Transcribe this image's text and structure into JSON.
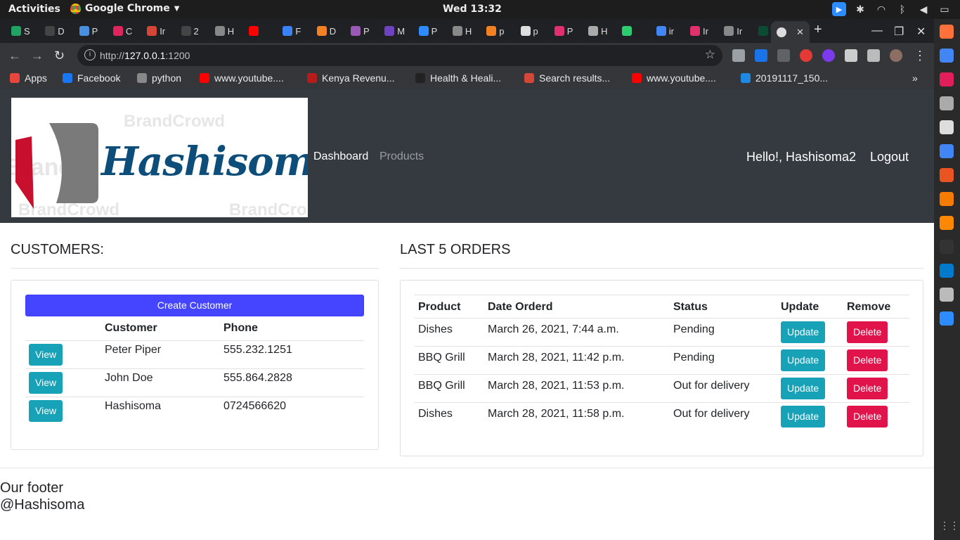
{
  "os": {
    "activities": "Activities",
    "app_name": "Google Chrome",
    "clock": "Wed 13:32"
  },
  "browser": {
    "tabs": [
      {
        "label": "S",
        "color": "#1fa463"
      },
      {
        "label": "D",
        "color": "#444"
      },
      {
        "label": "P",
        "color": "#4a90e2"
      },
      {
        "label": "C",
        "color": "#e0245e"
      },
      {
        "label": "Ir",
        "color": "#d44638"
      },
      {
        "label": "2",
        "color": "#444"
      },
      {
        "label": "H",
        "color": "#888"
      },
      {
        "label": "",
        "color": "#ff0000"
      },
      {
        "label": "F",
        "color": "#3b82f6"
      },
      {
        "label": "D",
        "color": "#f48024"
      },
      {
        "label": "P",
        "color": "#9b59b6"
      },
      {
        "label": "M",
        "color": "#6f42c1"
      },
      {
        "label": "P",
        "color": "#2d8cff"
      },
      {
        "label": "H",
        "color": "#888"
      },
      {
        "label": "p",
        "color": "#f48024"
      },
      {
        "label": "p",
        "color": "#ddd"
      },
      {
        "label": "P",
        "color": "#e1306c"
      },
      {
        "label": "H",
        "color": "#aaa"
      },
      {
        "label": "",
        "color": "#2ecc71"
      },
      {
        "label": "ir",
        "color": "#4285f4"
      },
      {
        "label": "Ir",
        "color": "#e1306c"
      },
      {
        "label": "Ir",
        "color": "#888"
      },
      {
        "label": "T",
        "color": "#0c4b33"
      }
    ],
    "url_scheme": "http://",
    "url_host": "127.0.0.1",
    "url_rest": ":1200"
  },
  "bookmarks": [
    {
      "label": "Apps",
      "color": "#e8453c"
    },
    {
      "label": "Facebook",
      "color": "#1877f2"
    },
    {
      "label": "python",
      "color": "#888"
    },
    {
      "label": "www.youtube....",
      "color": "#ff0000"
    },
    {
      "label": "Kenya Revenu...",
      "color": "#b71c1c"
    },
    {
      "label": "Health & Heali...",
      "color": "#222"
    },
    {
      "label": "Search results...",
      "color": "#d44638"
    },
    {
      "label": "www.youtube....",
      "color": "#ff0000"
    },
    {
      "label": "20191117_150...",
      "color": "#1e88e5"
    }
  ],
  "site": {
    "logo": {
      "brand": "Hashisoma",
      "watermark_1": "BrandCrowd",
      "watermark_2": "Brand",
      "watermark_3": "BrandCrowd",
      "watermark_4": "BrandCro"
    },
    "nav": {
      "dashboard": "Dashboard",
      "products": "Products",
      "greeting": "Hello!, Hashisoma2",
      "logout": "Logout"
    },
    "customers_title": "CUSTOMERS:",
    "orders_title": "LAST 5 ORDERS",
    "create_customer": "Create Customer",
    "customer_headers": {
      "col1": "",
      "col2": "Customer",
      "col3": "Phone"
    },
    "customers": [
      {
        "view": "View",
        "name": "Peter Piper",
        "phone": "555.232.1251"
      },
      {
        "view": "View",
        "name": "John Doe",
        "phone": "555.864.2828"
      },
      {
        "view": "View",
        "name": "Hashisoma",
        "phone": "0724566620"
      }
    ],
    "order_headers": {
      "product": "Product",
      "date": "Date Orderd",
      "status": "Status",
      "update": "Update",
      "remove": "Remove"
    },
    "orders": [
      {
        "product": "Dishes",
        "date": "March 26, 2021, 7:44 a.m.",
        "status": "Pending",
        "update": "Update",
        "delete": "Delete"
      },
      {
        "product": "BBQ Grill",
        "date": "March 28, 2021, 11:42 p.m.",
        "status": "Pending",
        "update": "Update",
        "delete": "Delete"
      },
      {
        "product": "BBQ Grill",
        "date": "March 28, 2021, 11:53 p.m.",
        "status": "Out for delivery",
        "update": "Update",
        "delete": "Delete"
      },
      {
        "product": "Dishes",
        "date": "March 28, 2021, 11:58 p.m.",
        "status": "Out for delivery",
        "update": "Update",
        "delete": "Delete"
      }
    ],
    "footer_line1": "Our footer",
    "footer_line2": "@Hashisoma"
  }
}
